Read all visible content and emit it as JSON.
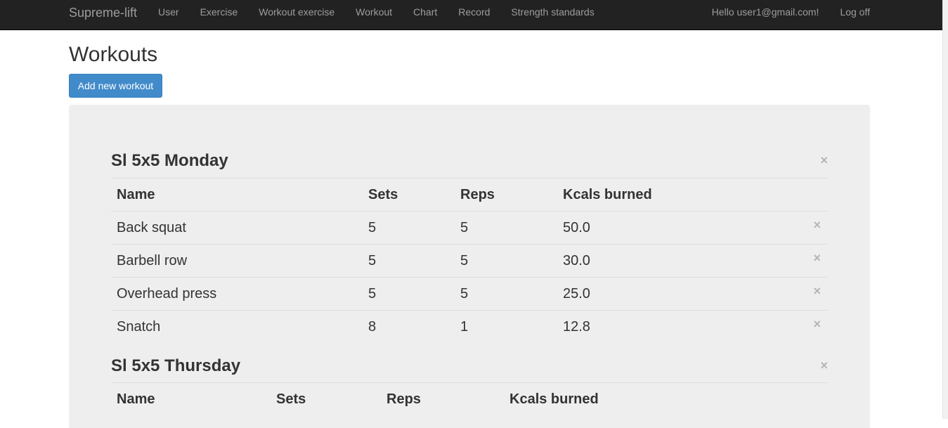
{
  "navbar": {
    "brand": "Supreme-lift",
    "links": [
      "User",
      "Exercise",
      "Workout exercise",
      "Workout",
      "Chart",
      "Record",
      "Strength standards"
    ],
    "greeting": "Hello user1@gmail.com!",
    "logoff": "Log off"
  },
  "page": {
    "title": "Workouts",
    "add_button": "Add new workout"
  },
  "columns": [
    "Name",
    "Sets",
    "Reps",
    "Kcals burned"
  ],
  "close_glyph": "×",
  "workouts": [
    {
      "title": "Sl 5x5 Monday",
      "rows": [
        {
          "name": "Back squat",
          "sets": "5",
          "reps": "5",
          "kcals": "50.0"
        },
        {
          "name": "Barbell row",
          "sets": "5",
          "reps": "5",
          "kcals": "30.0"
        },
        {
          "name": "Overhead press",
          "sets": "5",
          "reps": "5",
          "kcals": "25.0"
        },
        {
          "name": "Snatch",
          "sets": "8",
          "reps": "1",
          "kcals": "12.8"
        }
      ]
    },
    {
      "title": "Sl 5x5 Thursday",
      "rows": []
    }
  ]
}
